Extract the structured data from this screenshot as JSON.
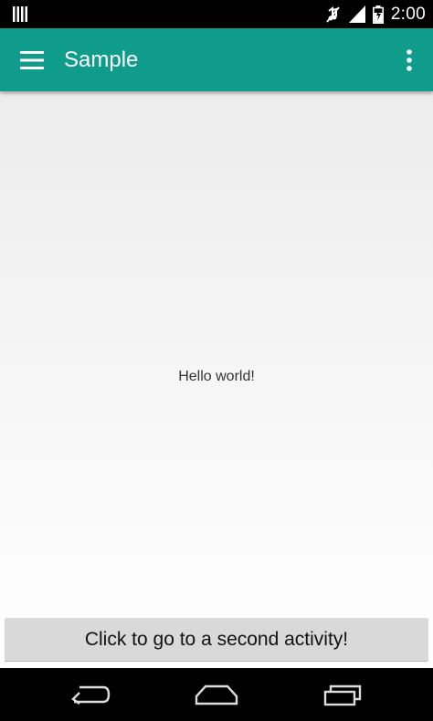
{
  "status_bar": {
    "time": "2:00",
    "icons": [
      "signal-bars-icon",
      "mute-icon",
      "cell-signal-icon",
      "battery-icon"
    ]
  },
  "app_bar": {
    "title": "Sample",
    "background_color": "#109c8c",
    "menu_icon": "hamburger-menu-icon",
    "overflow_icon": "overflow-menu-icon"
  },
  "content": {
    "hello_text": "Hello world!",
    "button_label": "Click to go to a second activity!"
  },
  "nav_bar": {
    "buttons": [
      "back-icon",
      "home-icon",
      "recents-icon"
    ]
  }
}
